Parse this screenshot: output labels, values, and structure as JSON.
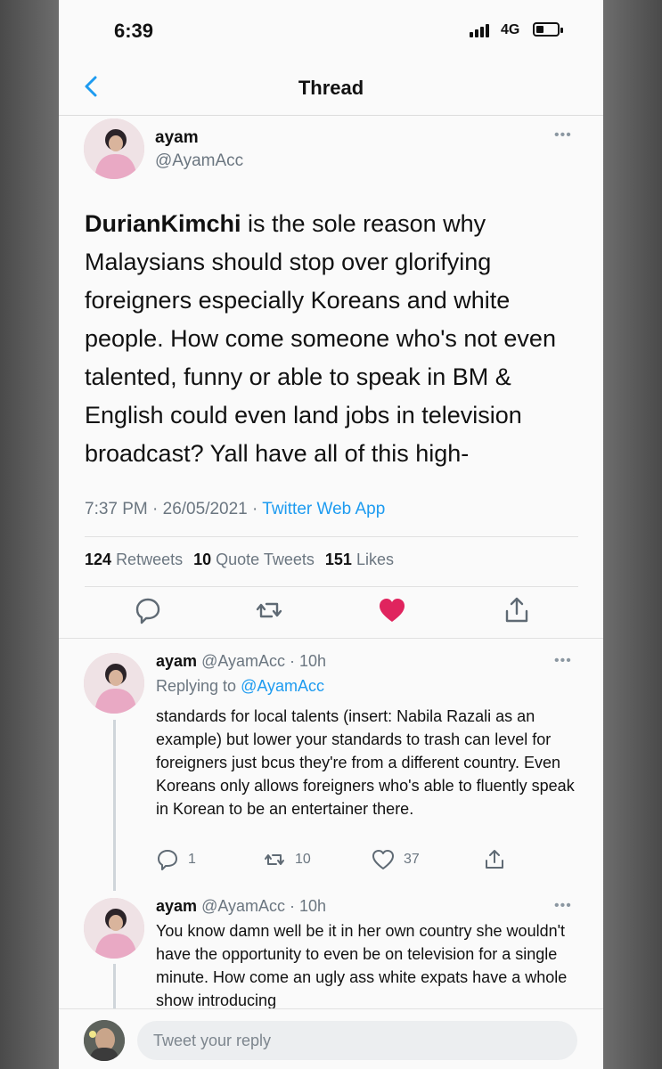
{
  "status_bar": {
    "time": "6:39",
    "network": "4G"
  },
  "header": {
    "title": "Thread"
  },
  "main_tweet": {
    "name": "ayam",
    "handle": "@AyamAcc",
    "text_bold": "DurianKimchi",
    "text_rest": " is the sole reason why Malaysians should stop over glorifying foreigners especially Koreans and white people. How come someone who's not even talented, funny or able to speak in BM & English could even land jobs in television broadcast? Yall have all of this high-",
    "time": "7:37 PM · 26/05/2021 · ",
    "app": "Twitter Web App",
    "stats": {
      "retweets_count": "124",
      "retweets_label": "Retweets",
      "quotes_count": "10",
      "quotes_label": "Quote Tweets",
      "likes_count": "151",
      "likes_label": "Likes"
    }
  },
  "replies": [
    {
      "name": "ayam",
      "handle_time": "@AyamAcc · 10h",
      "replying_prefix": "Replying to ",
      "replying_to": "@AyamAcc",
      "text": "standards for local talents (insert: Nabila Razali as an example) but lower your standards to trash can level for foreigners just bcus they're from a different country. Even Koreans only allows foreigners who's able to fluently speak in Korean to be an entertainer there.",
      "reply_count": "1",
      "retweet_count": "10",
      "like_count": "37"
    },
    {
      "name": "ayam",
      "handle_time": "@AyamAcc · 10h",
      "text": "You know damn well be it in her own country she wouldn't have the opportunity to even be on television for a single minute. How come an ugly ass white expats have a whole show introducing"
    }
  ],
  "compose": {
    "placeholder": "Tweet your reply"
  },
  "colors": {
    "accent": "#1d9bf0",
    "like": "#e0245e",
    "muted": "#6b7680"
  }
}
